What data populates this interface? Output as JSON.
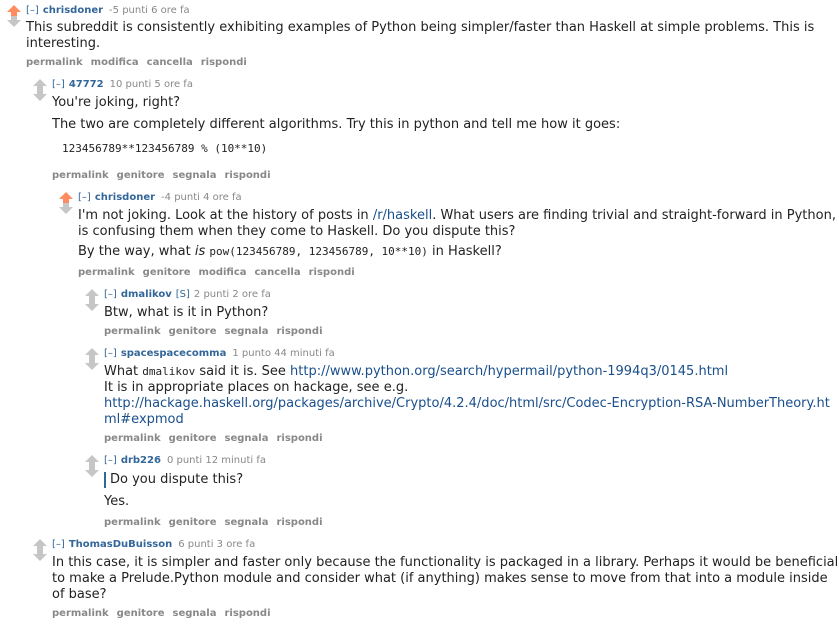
{
  "colors": {
    "upvoted": "#ff8b60",
    "neutral": "#c6c6c6",
    "link": "#369"
  },
  "comments": {
    "c1": {
      "toggle": "[–]",
      "author": "chrisdoner",
      "meta": "-5 punti 6 ore fa",
      "text": "This subreddit is consistently exhibiting examples of Python being simpler/faster than Haskell at simple problems. This is interesting.",
      "buttons": [
        "permalink",
        "modifica",
        "cancella",
        "rispondi"
      ]
    },
    "c2": {
      "toggle": "[–]",
      "author": "47772",
      "meta": "10 punti 5 ore fa",
      "p1": "You're joking, right?",
      "p2": "The two are completely different algorithms. Try this in python and tell me how it goes:",
      "code": "123456789**123456789 % (10**10)",
      "buttons": [
        "permalink",
        "genitore",
        "segnala",
        "rispondi"
      ]
    },
    "c3": {
      "toggle": "[–]",
      "author": "chrisdoner",
      "meta": "-4 punti 4 ore fa",
      "p1_a": "I'm not joking. Look at the history of posts in ",
      "p1_link": "/r/haskell",
      "p1_b": ". What users are finding trivial and straight-forward in Python, is confusing them when they come to Haskell. Do you dispute this?",
      "p2_a": "By the way, what ",
      "p2_em": "is",
      "p2_code": "pow(123456789, 123456789, 10**10)",
      "p2_b": " in Haskell?",
      "buttons": [
        "permalink",
        "genitore",
        "modifica",
        "cancella",
        "rispondi"
      ]
    },
    "c4": {
      "toggle": "[–]",
      "author": "dmalikov",
      "flair": "[S]",
      "meta": "2 punti 2 ore fa",
      "text": "Btw, what is it in Python?",
      "buttons": [
        "permalink",
        "genitore",
        "segnala",
        "rispondi"
      ]
    },
    "c5": {
      "toggle": "[–]",
      "author": "spacespacecomma",
      "meta": "1 punto 44 minuti fa",
      "l1_a": "What ",
      "l1_code": "dmalikov",
      "l1_b": " said it is. See ",
      "l1_link": "http://www.python.org/search/hypermail/python-1994q3/0145.html",
      "l2": "It is in appropriate places on hackage, see e.g.",
      "l3_link": "http://hackage.haskell.org/packages/archive/Crypto/4.2.4/doc/html/src/Codec-Encryption-RSA-NumberTheory.html#expmod",
      "buttons": [
        "permalink",
        "genitore",
        "segnala",
        "rispondi"
      ]
    },
    "c6": {
      "toggle": "[–]",
      "author": "drb226",
      "meta": "0 punti 12 minuti fa",
      "quote": "Do you dispute this?",
      "text": "Yes.",
      "buttons": [
        "permalink",
        "genitore",
        "segnala",
        "rispondi"
      ]
    },
    "c7": {
      "toggle": "[–]",
      "author": "ThomasDuBuisson",
      "meta": "6 punti 3 ore fa",
      "text": "In this case, it is simpler and faster only because the functionality is packaged in a library. Perhaps it would be beneficial to make a Prelude.Python module and consider what (if anything) makes sense to move from that into a module inside of base?",
      "buttons": [
        "permalink",
        "genitore",
        "segnala",
        "rispondi"
      ]
    }
  }
}
